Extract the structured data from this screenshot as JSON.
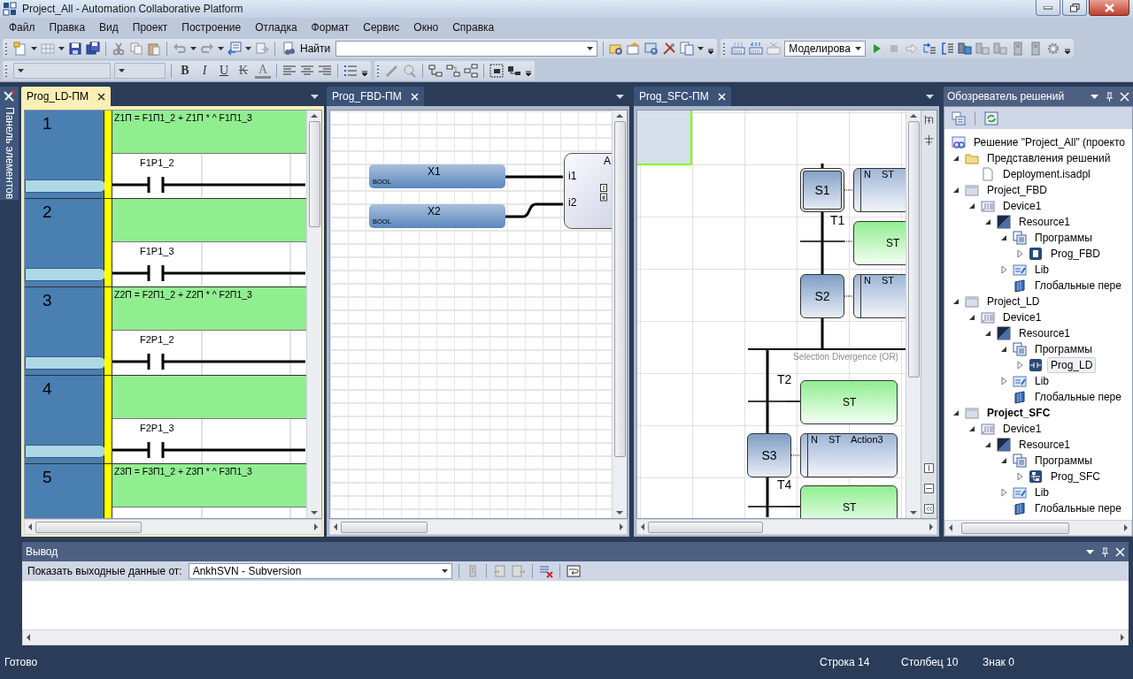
{
  "window": {
    "title": "Project_All - Automation Collaborative Platform"
  },
  "menu": [
    {
      "label": "Файл"
    },
    {
      "label": "Правка"
    },
    {
      "label": "Вид"
    },
    {
      "label": "Проект"
    },
    {
      "label": "Построение"
    },
    {
      "label": "Отладка"
    },
    {
      "label": "Формат"
    },
    {
      "label": "Сервис"
    },
    {
      "label": "Окно"
    },
    {
      "label": "Справка"
    }
  ],
  "toolbar": {
    "find_label": "Найти",
    "mode": "Моделирова"
  },
  "format_buttons": [
    {
      "label": "B",
      "kind": "bold"
    },
    {
      "label": "I",
      "kind": "italic"
    },
    {
      "label": "U",
      "kind": "underline"
    },
    {
      "label": "K",
      "kind": "strike"
    },
    {
      "label": "A",
      "kind": "color"
    }
  ],
  "toolbox_tab": "Панель элементов",
  "documents": [
    {
      "kind": "ld",
      "tab": "Prog_LD-ПМ",
      "selected": true,
      "rungs": [
        {
          "number": "1",
          "comment": "Z1П = F1П1_2 + Z1П * ^ F1П1_3",
          "contact": "F1P1_2"
        },
        {
          "number": "2",
          "contact": "F1P1_3"
        },
        {
          "number": "3",
          "comment": "Z2П = F2П1_2 + Z2П * ^ F2П1_3",
          "contact": "F2P1_2"
        },
        {
          "number": "4",
          "contact": "F2P1_3"
        },
        {
          "number": "5",
          "comment": "Z3П = F3П1_2 + Z3П * ^ F3П1_3"
        }
      ]
    },
    {
      "kind": "fbd",
      "tab": "Prog_FBD-ПМ",
      "selected": false,
      "variables": [
        {
          "name": "X1",
          "type": "BOOL"
        },
        {
          "name": "X2",
          "type": "BOOL"
        }
      ],
      "block": {
        "title": "A",
        "inputs": [
          "i1",
          "i2"
        ]
      }
    },
    {
      "kind": "sfc",
      "tab": "Prog_SFC-ПМ",
      "selected": false,
      "steps": [
        {
          "name": "S1",
          "initial": true,
          "action": {
            "qualifier": "N",
            "language": "ST"
          }
        },
        {
          "name": "S2",
          "initial": false,
          "action": {
            "qualifier": "N",
            "language": "ST"
          }
        },
        {
          "name": "S3",
          "initial": false,
          "action": {
            "qualifier": "N",
            "language": "ST",
            "name": "Action3"
          }
        }
      ],
      "transitions": [
        {
          "name": "T1",
          "condition": "ST"
        },
        {
          "name": "T2",
          "condition": "ST"
        },
        {
          "name": "T4",
          "condition": "ST"
        }
      ],
      "divergence": "Selection Divergence (OR)"
    }
  ],
  "explorer": {
    "title": "Обозреватель решений",
    "tree": [
      {
        "label": "Решение \"Project_All\"  (проекто",
        "kind": "solution",
        "selected": false,
        "children": [
          {
            "label": "Представления решений",
            "kind": "folder",
            "selected": false,
            "expanded": true,
            "children": [
              {
                "label": "Deployment.isadpl",
                "kind": "file",
                "selected": false
              }
            ]
          },
          {
            "label": "Project_FBD",
            "kind": "project",
            "selected": false,
            "expanded": true,
            "children": [
              {
                "label": "Device1",
                "kind": "device",
                "selected": false,
                "expanded": true,
                "children": [
                  {
                    "label": "Resource1",
                    "kind": "resource",
                    "selected": false,
                    "expanded": true,
                    "children": [
                      {
                        "label": "Программы",
                        "kind": "programs",
                        "selected": false,
                        "expanded": true,
                        "children": [
                          {
                            "label": "Prog_FBD",
                            "kind": "program_fbd",
                            "selected": false,
                            "expanded": false
                          }
                        ]
                      },
                      {
                        "label": "Lib",
                        "kind": "lib",
                        "selected": false,
                        "expanded": false
                      },
                      {
                        "label": "Глобальные пере",
                        "kind": "globals",
                        "selected": false
                      }
                    ]
                  }
                ]
              }
            ]
          },
          {
            "label": "Project_LD",
            "kind": "project",
            "selected": false,
            "expanded": true,
            "children": [
              {
                "label": "Device1",
                "kind": "device",
                "selected": false,
                "expanded": true,
                "children": [
                  {
                    "label": "Resource1",
                    "kind": "resource",
                    "selected": false,
                    "expanded": true,
                    "children": [
                      {
                        "label": "Программы",
                        "kind": "programs",
                        "selected": false,
                        "expanded": true,
                        "children": [
                          {
                            "label": "Prog_LD",
                            "kind": "program_ld",
                            "selected": true,
                            "expanded": false
                          }
                        ]
                      },
                      {
                        "label": "Lib",
                        "kind": "lib",
                        "selected": false,
                        "expanded": false
                      },
                      {
                        "label": "Глобальные пере",
                        "kind": "globals",
                        "selected": false
                      }
                    ]
                  }
                ]
              }
            ]
          },
          {
            "label": "Project_SFC",
            "kind": "project",
            "selected": false,
            "expanded": true,
            "bold": true,
            "children": [
              {
                "label": "Device1",
                "kind": "device",
                "selected": false,
                "expanded": true,
                "children": [
                  {
                    "label": "Resource1",
                    "kind": "resource",
                    "selected": false,
                    "expanded": true,
                    "children": [
                      {
                        "label": "Программы",
                        "kind": "programs",
                        "selected": false,
                        "expanded": true,
                        "children": [
                          {
                            "label": "Prog_SFC",
                            "kind": "program_sfc",
                            "selected": false,
                            "expanded": false
                          }
                        ]
                      },
                      {
                        "label": "Lib",
                        "kind": "lib",
                        "selected": false,
                        "expanded": false
                      },
                      {
                        "label": "Глобальные пере",
                        "kind": "globals",
                        "selected": false
                      }
                    ]
                  }
                ]
              }
            ]
          }
        ]
      }
    ]
  },
  "output": {
    "title": "Вывод",
    "source_label": "Показать выходные данные от:",
    "source": "AnkhSVN - Subversion"
  },
  "status_bar": {
    "message": "Готово",
    "line": "Строка 14",
    "column": "Столбец 10",
    "char": "Знак 0"
  }
}
